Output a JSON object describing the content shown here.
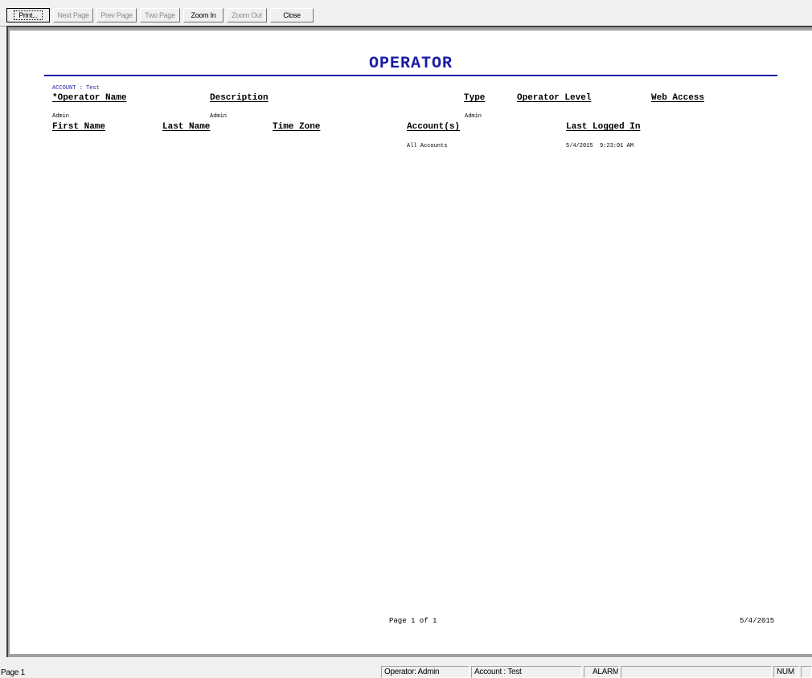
{
  "toolbar": {
    "print": "Print...",
    "next_page": "Next Page",
    "prev_page": "Prev Page",
    "two_page": "Two Page",
    "zoom_in": "Zoom In",
    "zoom_out": "Zoom Out",
    "close": "Close"
  },
  "report": {
    "title": "OPERATOR",
    "account_line": "ACCOUNT : Test",
    "headers_row1": {
      "operator_name": "*Operator Name",
      "description": "Description",
      "type": "Type",
      "operator_level": "Operator Level",
      "web_access": "Web Access"
    },
    "values_row1": {
      "operator_name": "Admin",
      "description": "Admin",
      "type": "Admin",
      "operator_level": "",
      "web_access": ""
    },
    "headers_row2": {
      "first_name": "First Name",
      "last_name": "Last Name",
      "time_zone": "Time Zone",
      "accounts": "Account(s)",
      "last_logged_in": "Last Logged In"
    },
    "values_row2": {
      "accounts": "All Accounts",
      "last_logged_in": "5/4/2015  9:23:01 AM"
    },
    "footer": {
      "page": "Page 1 of 1",
      "date": "5/4/2015"
    }
  },
  "statusbar": {
    "page": "Page 1",
    "operator": "Operator: Admin",
    "account": "Account : Test",
    "alarm": "ALARM",
    "num": "NUM"
  },
  "colors": {
    "report_accent": "#1a1aa6"
  }
}
